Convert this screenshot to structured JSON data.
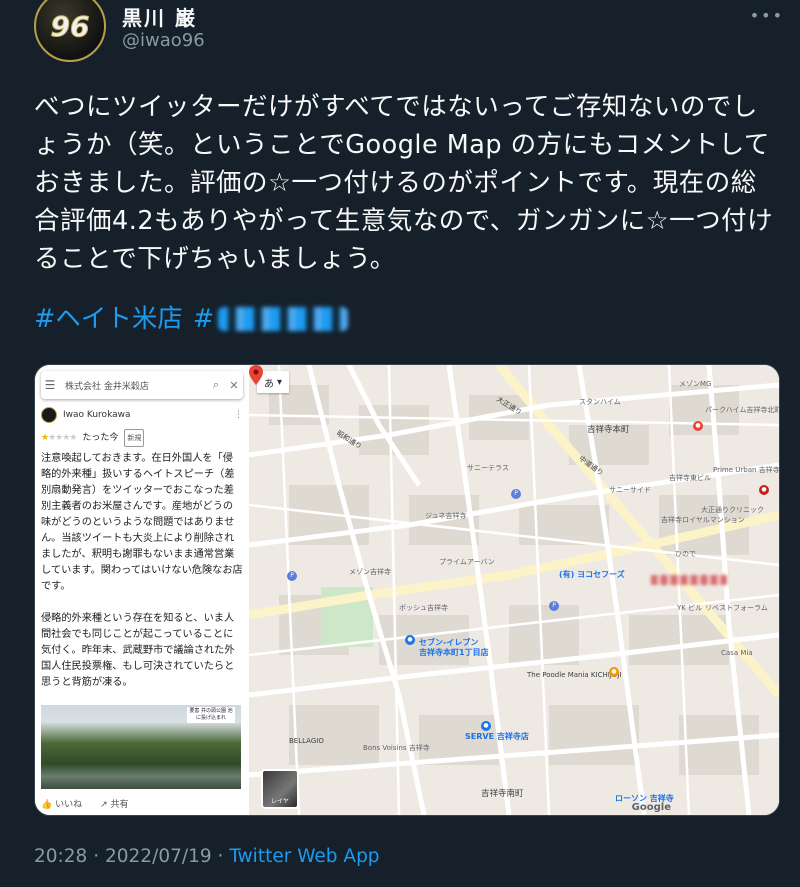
{
  "tweet": {
    "author_name": "黒川 巌",
    "author_handle": "@iwao96",
    "avatar_text": "96",
    "more_label": "•••",
    "text": "べつにツイッターだけがすべてではないってご存知ないのでしょうか（笑。ということでGoogle Map の方にもコメントしておきました。評価の☆一つ付けるのがポイントです。現在の総合評価4.2もありやがって生意気なので、ガンガンに☆一つ付けることで下げちゃいましょう。",
    "hashtags": [
      "#ヘイト米店",
      "#"
    ],
    "time": "20:28",
    "date": "2022/07/19",
    "separator": "·",
    "app": "Twitter Web App"
  },
  "maps_screenshot": {
    "search_query": "株式会社 金井米穀店",
    "search_icon": "search-icon",
    "close_icon": "close-icon",
    "reviewer_name": "Iwao Kurokawa",
    "rating": 1,
    "rating_max": 5,
    "review_time": "たった今",
    "new_badge": "新規",
    "review_text": "注意喚起しておきます。在日外国人を「侵略的外来種」扱いするヘイトスピーチ（差別扇動発言）をツイッターでおこなった差別主義者のお米屋さんです。産地がどうの味がどうのというような問題ではありません。当該ツイートも大炎上により削除されましたが、釈明も謝罪もないまま通常営業しています。関わってはいけない危険なお店です。\n\n侵略的外来種という存在を知ると、いま人間社会でも同じことが起こっていることに気付く。昨年末、武蔵野市で議論された外国人住民投票権、もし可決されていたらと思うと背筋が凍る。",
    "photo_sign": "要害 井の頭公園 池に投げ込まれ",
    "like_label": "いいね",
    "share_label": "共有",
    "lang_control": "あ",
    "layer_label": "レイヤ",
    "google_label": "Google",
    "map_labels": [
      "吉祥寺本町",
      "大正通り",
      "昭和通り",
      "吉祥寺南町",
      "中道通り",
      "(有) ヨコセフーズ",
      "セブン-イレブン",
      "吉祥寺本町1丁目店",
      "The Poodle Mania KICHIJOJI",
      "SERVE 吉祥寺店",
      "Bons Voisins 吉祥寺",
      "BELLAGIO",
      "ローソン 吉祥寺",
      "メゾンMG",
      "スタンハイム",
      "サニーテラス",
      "ジュネ吉祥寺",
      "プライムアーバン",
      "パークハイム吉祥寺北町",
      "吉祥寺東ビル",
      "吉祥寺ロイヤルマンション",
      "サニーサイド",
      "ひので",
      "YK ビル",
      "リベストフォーラム",
      "Casa Mia",
      "大正通りクリニック",
      "Prime Urban 吉祥寺",
      "ボッシュ吉祥寺",
      "メゾン吉祥寺"
    ]
  }
}
